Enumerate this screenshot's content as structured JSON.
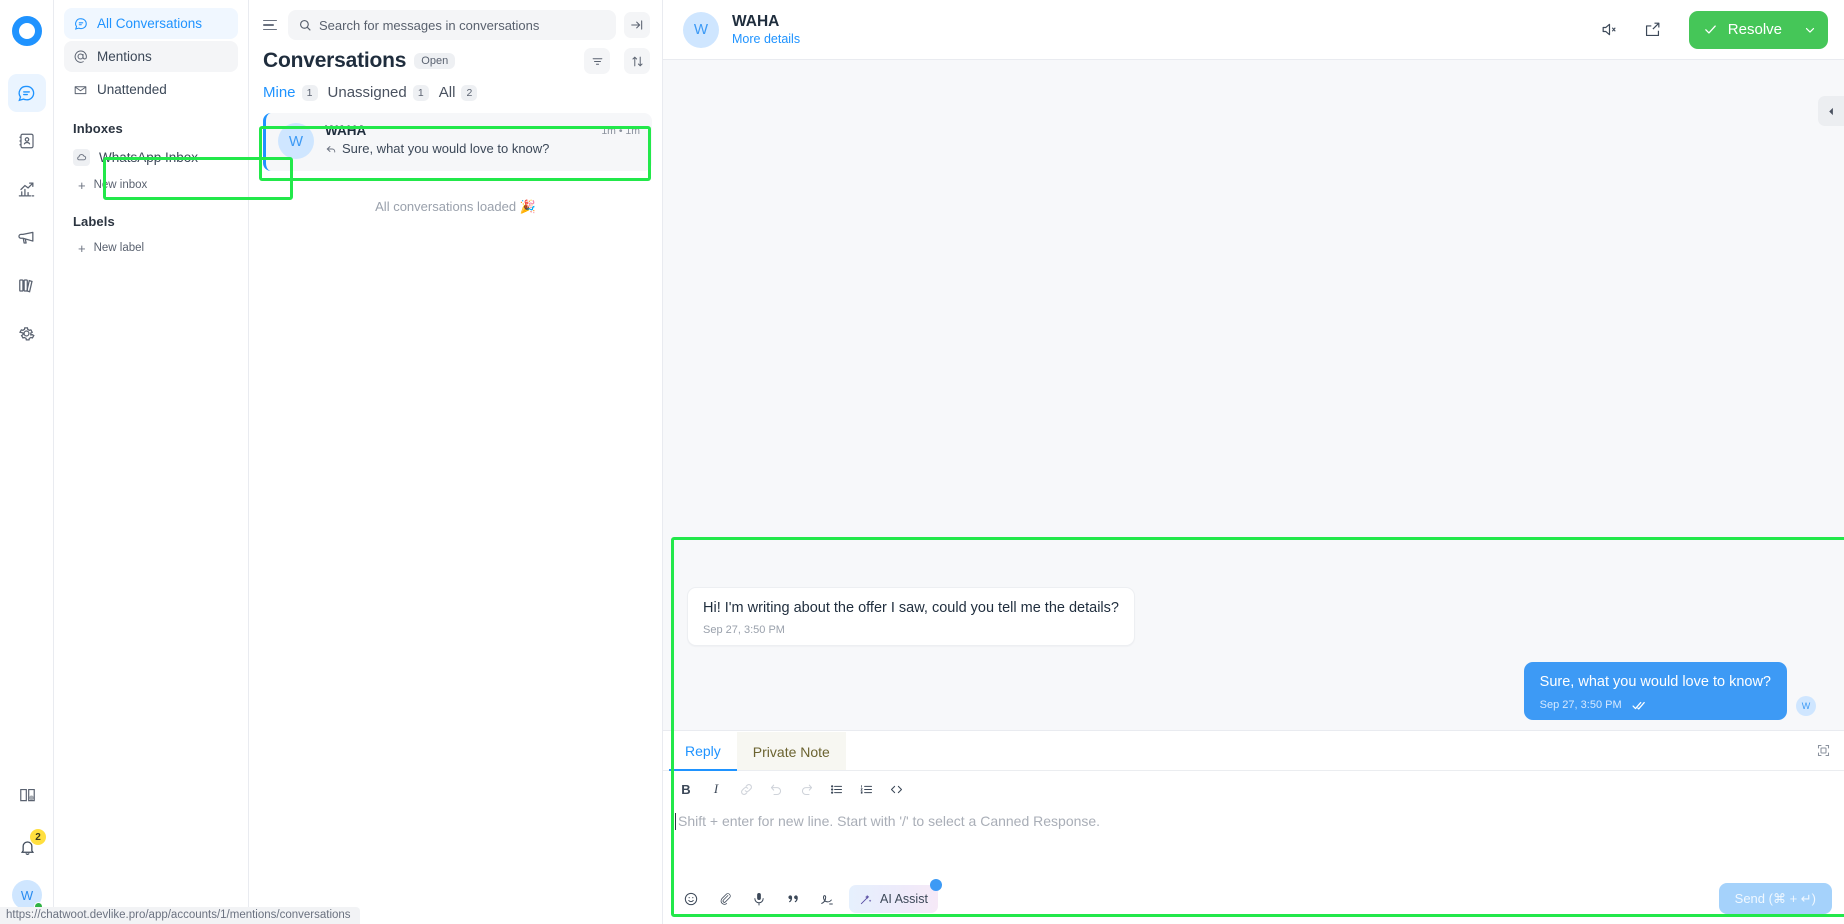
{
  "rail": {
    "logo": "chatwoot-logo",
    "items": [
      {
        "name": "conversations",
        "icon": "chat-bubble-icon",
        "active": true
      },
      {
        "name": "contacts",
        "icon": "contact-book-icon",
        "active": false
      },
      {
        "name": "reports",
        "icon": "reports-chart-icon",
        "active": false
      },
      {
        "name": "campaigns",
        "icon": "megaphone-icon",
        "active": false
      },
      {
        "name": "help-center",
        "icon": "books-icon",
        "active": false
      },
      {
        "name": "settings",
        "icon": "gear-icon",
        "active": false
      }
    ],
    "bottom": {
      "docs_icon": "book-globe-icon",
      "notifications_icon": "bell-icon",
      "notifications_count": "2",
      "avatar_initial": "W"
    }
  },
  "sidebar": {
    "nav": [
      {
        "label": "All Conversations",
        "icon": "chat-bubble-icon",
        "state": "active"
      },
      {
        "label": "Mentions",
        "icon": "at-icon",
        "state": "hovered"
      },
      {
        "label": "Unattended",
        "icon": "envelope-icon",
        "state": "default"
      }
    ],
    "inboxes_title": "Inboxes",
    "inboxes": [
      {
        "label": "WhatsApp Inbox",
        "icon": "whatsapp-cloud-icon"
      }
    ],
    "new_inbox_label": "New inbox",
    "labels_title": "Labels",
    "new_label_label": "New label"
  },
  "convlist": {
    "search": {
      "placeholder": "Search for messages in conversations",
      "icon": "search-icon"
    },
    "menu_icon": "hamburger-icon",
    "collapse_icon": "collapse-panel-icon",
    "title": "Conversations",
    "status_pill": "Open",
    "filter_icon": "filter-icon",
    "sort_icon": "sort-icon",
    "tabs": [
      {
        "label": "Mine",
        "count": "1",
        "active": true
      },
      {
        "label": "Unassigned",
        "count": "1",
        "active": false
      },
      {
        "label": "All",
        "count": "2",
        "active": false
      }
    ],
    "conversations": [
      {
        "avatar_initial": "W",
        "name": "WAHA",
        "preview": "Sure, what you would love to know?",
        "preview_icon": "reply-arrow-icon",
        "time": "1m • 1m"
      }
    ],
    "loaded_note": "All conversations loaded 🎉"
  },
  "chat": {
    "header": {
      "avatar_initial": "W",
      "name": "WAHA",
      "more_details": "More details",
      "mute_icon": "mute-speaker-icon",
      "share_icon": "share-box-icon",
      "resolve_label": "Resolve",
      "resolve_check_icon": "check-icon",
      "resolve_caret_icon": "chevron-down-icon",
      "resolve_color": "#45c658"
    },
    "collapse_sidebar_icon": "chevron-left-icon",
    "messages": [
      {
        "direction": "incoming",
        "text": "Hi! I'm writing about the offer I saw, could you tell me the details?",
        "time": "Sep 27, 3:50 PM"
      },
      {
        "direction": "outgoing",
        "text": "Sure, what you would love to know?",
        "time": "Sep 27, 3:50 PM",
        "status_icon": "double-check-icon",
        "avatar_initial": "W"
      }
    ]
  },
  "reply": {
    "tabs": [
      {
        "label": "Reply",
        "active": true
      },
      {
        "label": "Private Note",
        "active": false
      }
    ],
    "expand_icon": "expand-editor-icon",
    "format_buttons": [
      {
        "name": "bold",
        "glyph": "B",
        "enabled": true
      },
      {
        "name": "italic",
        "glyph": "I",
        "enabled": true
      },
      {
        "name": "link",
        "glyph": "link-icon",
        "enabled": false
      },
      {
        "name": "undo",
        "glyph": "undo-icon",
        "enabled": false
      },
      {
        "name": "redo",
        "glyph": "redo-icon",
        "enabled": false
      },
      {
        "name": "bullet-list",
        "glyph": "bullet-list-icon",
        "enabled": true
      },
      {
        "name": "ordered-list",
        "glyph": "ordered-list-icon",
        "enabled": true
      },
      {
        "name": "code-block",
        "glyph": "code-icon",
        "enabled": true
      }
    ],
    "editor_placeholder": "Shift + enter for new line. Start with '/' to select a Canned Response.",
    "editor_value": "",
    "bottom_buttons": [
      {
        "name": "emoji",
        "icon": "smiley-icon"
      },
      {
        "name": "attach-file",
        "icon": "paperclip-icon"
      },
      {
        "name": "voice-record",
        "icon": "microphone-icon"
      },
      {
        "name": "canned-response",
        "icon": "quote-icon"
      },
      {
        "name": "signature",
        "icon": "signature-icon"
      }
    ],
    "ai_assist_label": "AI Assist",
    "ai_assist_icon": "magic-wand-icon",
    "send_label": "Send (⌘ + ↵)"
  },
  "statusbar": {
    "url": "https://chatwoot.devlike.pro/app/accounts/1/mentions/conversations"
  },
  "highlight_color": "#22e84a"
}
